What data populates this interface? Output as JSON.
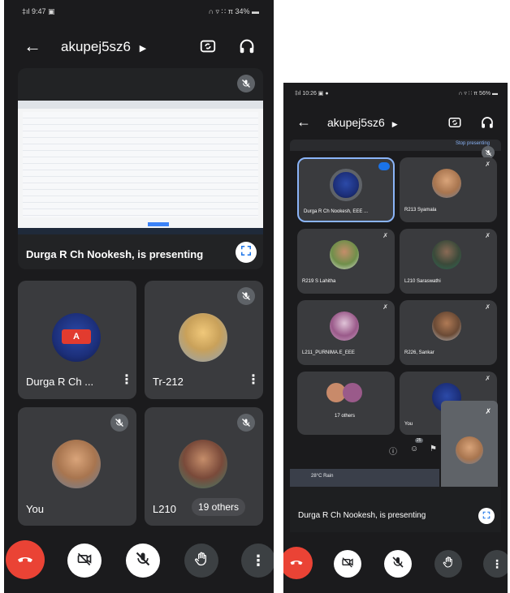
{
  "left": {
    "status": {
      "left": "‡ıl 9:47 ▣",
      "right": "∩ ▿ ∷ π 34% ▬"
    },
    "meeting_code": "akupej5sz6",
    "presenting_caption": "Durga R Ch Nookesh, is presenting",
    "tiles": [
      {
        "name": "Durga R Ch ..."
      },
      {
        "name": "Tr-212"
      },
      {
        "name": "You"
      },
      {
        "name": "L210"
      }
    ],
    "others_badge": "19 others"
  },
  "right": {
    "status": {
      "left": "‡ıl 10:26 ▣ ●",
      "right": "∩ ▿ ∷ π 56% ▬"
    },
    "meeting_code": "akupej5sz6",
    "top_strip_text": "Stop presenting",
    "tiles": [
      {
        "name": "Durga R Ch Nookesh, EEE ..."
      },
      {
        "name": "R213 Syamala"
      },
      {
        "name": "R219 S Lahitha"
      },
      {
        "name": "L210 Saraswathi"
      },
      {
        "name": "L211_PURNIMA.E_EEE"
      },
      {
        "name": "R226, Sankar"
      },
      {
        "name": "17 others"
      },
      {
        "name": "You"
      }
    ],
    "participants_count": "25",
    "taskbar_text": "28°C Rain",
    "presenting_caption": "Durga R Ch Nookesh, is presenting"
  }
}
